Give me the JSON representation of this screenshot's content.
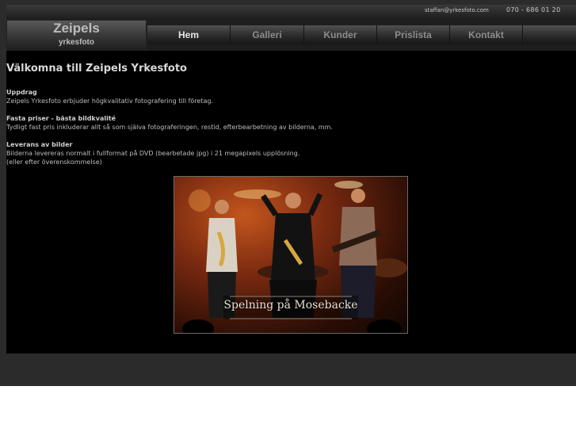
{
  "topbar": {
    "email": "staffan@yrkesfoto.com",
    "phone": "070 - 686 01 20"
  },
  "logo": {
    "title": "Zeipels",
    "subtitle": "yrkesfoto"
  },
  "nav": {
    "items": [
      {
        "label": "Hem",
        "active": true
      },
      {
        "label": "Galleri"
      },
      {
        "label": "Kunder"
      },
      {
        "label": "Prislista"
      },
      {
        "label": "Kontakt"
      }
    ]
  },
  "main": {
    "title": "Välkomna till Zeipels Yrkesfoto",
    "sections": [
      {
        "heading": "Uppdrag",
        "lines": [
          "Zeipels Yrkesfoto erbjuder högkvalitativ fotografering till företag."
        ]
      },
      {
        "heading": "Fasta priser - bästa bildkvalité",
        "lines": [
          "Tydligt fast pris inkluderar allt så som själva fotograferingen, restid, efterbearbetning av bilderna, mm."
        ]
      },
      {
        "heading": "Leverans av bilder",
        "lines": [
          "Bilderna levereras normalt i fullformat på DVD (bearbetade jpg) i 21 megapixels upplösning.",
          "(eller efter överenskommelse)"
        ]
      }
    ],
    "photo_caption": "Spelning på Mosebacke"
  },
  "colors": {
    "background": "#2b2b2b",
    "content_bg": "#000000",
    "nav_active": "#e6e6e6",
    "nav_inactive": "#8c8c8c"
  }
}
